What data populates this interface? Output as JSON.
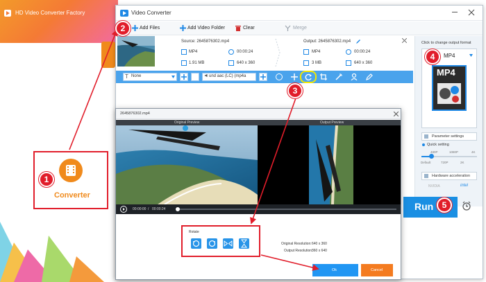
{
  "home_window": {
    "title": "HD Video Converter Factory",
    "converter_label": "Converter"
  },
  "converter_window": {
    "title": "Video Converter",
    "toolbar": {
      "add_files": "Add Files",
      "add_video_folder": "Add Video Folder",
      "clear": "Clear",
      "merge": "Merge"
    },
    "file_row": {
      "source_name": "Source: 2645876302.mp4",
      "source_format": "MP4",
      "source_duration": "00:00:24",
      "source_size": "1.91 MB",
      "source_resolution": "640 x 360",
      "output_name": "Output: 2645876302.mp4",
      "output_format": "MP4",
      "output_duration": "00:00:24",
      "output_size": "3 MB",
      "output_resolution": "640 x 360"
    },
    "edit_bar": {
      "subtitle_value": "None",
      "audio_value": "und aac (LC) (mp4a"
    }
  },
  "right_panel": {
    "click_to_change": "Click to change output format",
    "format_value": "MP4",
    "format_icon_text": "MP4",
    "parameter_settings": "Parameter settings",
    "quick_setting": "Quick setting",
    "quality_labels": [
      "480P",
      "1080P",
      "4K"
    ],
    "quality_labels_bottom": [
      "Default",
      "720P",
      "2K"
    ],
    "hardware_acceleration": "Hardware acceleration",
    "hw_nvidia": "NVIDIA",
    "hw_intel": "intel",
    "run_label": "Run"
  },
  "rotate_dialog": {
    "title": "2645876302.mp4",
    "original_preview": "Original Preview",
    "output_preview": "Output Preview",
    "time_current": "00:00:00",
    "time_sep": "/",
    "time_total": "00:00:24",
    "rotate_label": "Rotate",
    "original_resolution_label": "Original Resolution:",
    "original_resolution_value": "640 x 360",
    "output_resolution_label": "Output Resolution:",
    "output_resolution_value": "360 x 640",
    "ok_label": "Ok",
    "cancel_label": "Cancel"
  },
  "steps": [
    "1",
    "2",
    "3",
    "4",
    "5"
  ],
  "colors": {
    "accent_blue": "#1e88e5",
    "callout_red": "#e11d2a",
    "run_blue": "#1a8fe3",
    "cancel_orange": "#f47b20",
    "converter_orange": "#f08a1c"
  }
}
